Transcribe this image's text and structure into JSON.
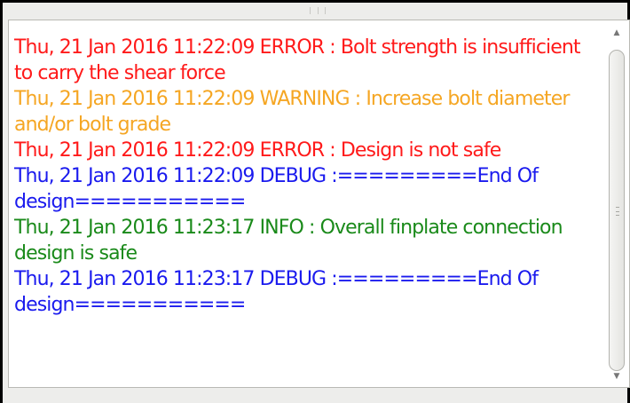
{
  "log": {
    "entries": [
      {
        "level": "ERROR",
        "color": "#ff1a1a",
        "text": "Thu, 21 Jan 2016 11:22:09 ERROR : Bolt strength is insufficient to carry the shear force"
      },
      {
        "level": "WARNING",
        "color": "#f5a623",
        "text": "Thu, 21 Jan 2016 11:22:09 WARNING : Increase bolt diameter and/or bolt grade"
      },
      {
        "level": "ERROR",
        "color": "#ff1a1a",
        "text": "Thu, 21 Jan 2016 11:22:09 ERROR : Design is not safe"
      },
      {
        "level": "DEBUG",
        "color": "#1a1aee",
        "text": "Thu, 21 Jan 2016 11:22:09 DEBUG :=========End Of design==========="
      },
      {
        "level": "INFO",
        "color": "#1a8a1a",
        "text": "Thu, 21 Jan 2016 11:23:17 INFO : Overall finplate connection design is safe"
      },
      {
        "level": "DEBUG",
        "color": "#1a1aee",
        "text": "Thu, 21 Jan 2016 11:23:17 DEBUG :=========End Of design==========="
      }
    ]
  },
  "scrollbar": {
    "up_icon": "chevron-up-icon",
    "down_icon": "chevron-down-icon",
    "grip_icon": "grip-icon",
    "up_glyph": "▲",
    "down_glyph": "▼"
  }
}
